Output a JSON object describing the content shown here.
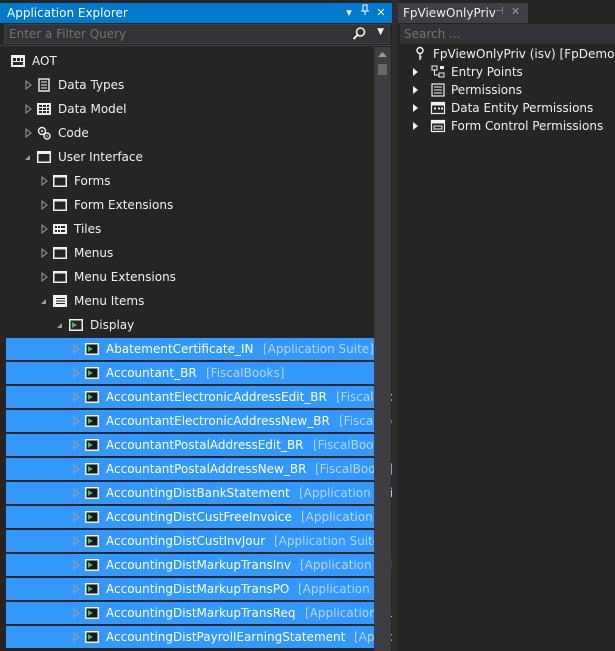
{
  "explorer": {
    "title": "Application Explorer",
    "filter_placeholder": "Enter a Filter Query",
    "tree": [
      {
        "label": "AOT",
        "tag": "",
        "icon": "aot-icon",
        "expanded": true,
        "selected": false
      },
      {
        "label": "Data Types",
        "tag": "",
        "icon": "data-types-icon",
        "expanded": false,
        "selected": false
      },
      {
        "label": "Data Model",
        "tag": "",
        "icon": "data-model-icon",
        "expanded": false,
        "selected": false
      },
      {
        "label": "Code",
        "tag": "",
        "icon": "code-icon",
        "expanded": false,
        "selected": false
      },
      {
        "label": "User Interface",
        "tag": "",
        "icon": "user-interface-icon",
        "expanded": true,
        "selected": false
      },
      {
        "label": "Forms",
        "tag": "",
        "icon": "folder-icon",
        "expanded": false,
        "selected": false
      },
      {
        "label": "Form Extensions",
        "tag": "",
        "icon": "folder-icon",
        "expanded": false,
        "selected": false
      },
      {
        "label": "Tiles",
        "tag": "",
        "icon": "tiles-icon",
        "expanded": false,
        "selected": false
      },
      {
        "label": "Menus",
        "tag": "",
        "icon": "folder-icon",
        "expanded": false,
        "selected": false
      },
      {
        "label": "Menu Extensions",
        "tag": "",
        "icon": "folder-icon",
        "expanded": false,
        "selected": false
      },
      {
        "label": "Menu Items",
        "tag": "",
        "icon": "menu-items-icon",
        "expanded": true,
        "selected": false
      },
      {
        "label": "Display",
        "tag": "",
        "icon": "display-icon",
        "expanded": true,
        "selected": false
      },
      {
        "label": "AbatementCertificate_IN",
        "tag": "[Application Suite]",
        "icon": "menu-item-icon",
        "expanded": false,
        "selected": true
      },
      {
        "label": "Accountant_BR",
        "tag": "[FiscalBooks]",
        "icon": "menu-item-icon",
        "expanded": false,
        "selected": true
      },
      {
        "label": "AccountantElectronicAddressEdit_BR",
        "tag": "[FiscalBooks]",
        "icon": "menu-item-icon",
        "expanded": false,
        "selected": true
      },
      {
        "label": "AccountantElectronicAddressNew_BR",
        "tag": "[FiscalBooks]",
        "icon": "menu-item-icon",
        "expanded": false,
        "selected": true
      },
      {
        "label": "AccountantPostalAddressEdit_BR",
        "tag": "[FiscalBooks]",
        "icon": "menu-item-icon",
        "expanded": false,
        "selected": true
      },
      {
        "label": "AccountantPostalAddressNew_BR",
        "tag": "[FiscalBooks]",
        "icon": "menu-item-icon",
        "expanded": false,
        "selected": true
      },
      {
        "label": "AccountingDistBankStatement",
        "tag": "[Application Suite]",
        "icon": "menu-item-icon",
        "expanded": false,
        "selected": true
      },
      {
        "label": "AccountingDistCustFreeInvoice",
        "tag": "[Application Suite]",
        "icon": "menu-item-icon",
        "expanded": false,
        "selected": true
      },
      {
        "label": "AccountingDistCustInvJour",
        "tag": "[Application Suite]",
        "icon": "menu-item-icon",
        "expanded": false,
        "selected": true
      },
      {
        "label": "AccountingDistMarkupTransInv",
        "tag": "[Application Suite]",
        "icon": "menu-item-icon",
        "expanded": false,
        "selected": true
      },
      {
        "label": "AccountingDistMarkupTransPO",
        "tag": "[Application Suite]",
        "icon": "menu-item-icon",
        "expanded": false,
        "selected": true
      },
      {
        "label": "AccountingDistMarkupTransReq",
        "tag": "[Application Suite]",
        "icon": "menu-item-icon",
        "expanded": false,
        "selected": true
      },
      {
        "label": "AccountingDistPayrollEarningStatement",
        "tag": "[Application Suite]",
        "icon": "menu-item-icon",
        "expanded": false,
        "selected": true
      }
    ]
  },
  "designer": {
    "tab_title": "FpViewOnlyPriv",
    "search_placeholder": "Search ...",
    "root": {
      "label": "FpViewOnlyPriv (isv) [FpDemo]",
      "icon": "key-icon"
    },
    "nodes": [
      {
        "label": "Entry Points",
        "icon": "entry-points-icon"
      },
      {
        "label": "Permissions",
        "icon": "permissions-icon"
      },
      {
        "label": "Data Entity Permissions",
        "icon": "data-entity-permissions-icon"
      },
      {
        "label": "Form Control Permissions",
        "icon": "form-control-permissions-icon"
      }
    ]
  },
  "colors": {
    "accent": "#007acc",
    "selection": "#3399ff",
    "background": "#252526",
    "tag_text": "#b7d4f3"
  }
}
